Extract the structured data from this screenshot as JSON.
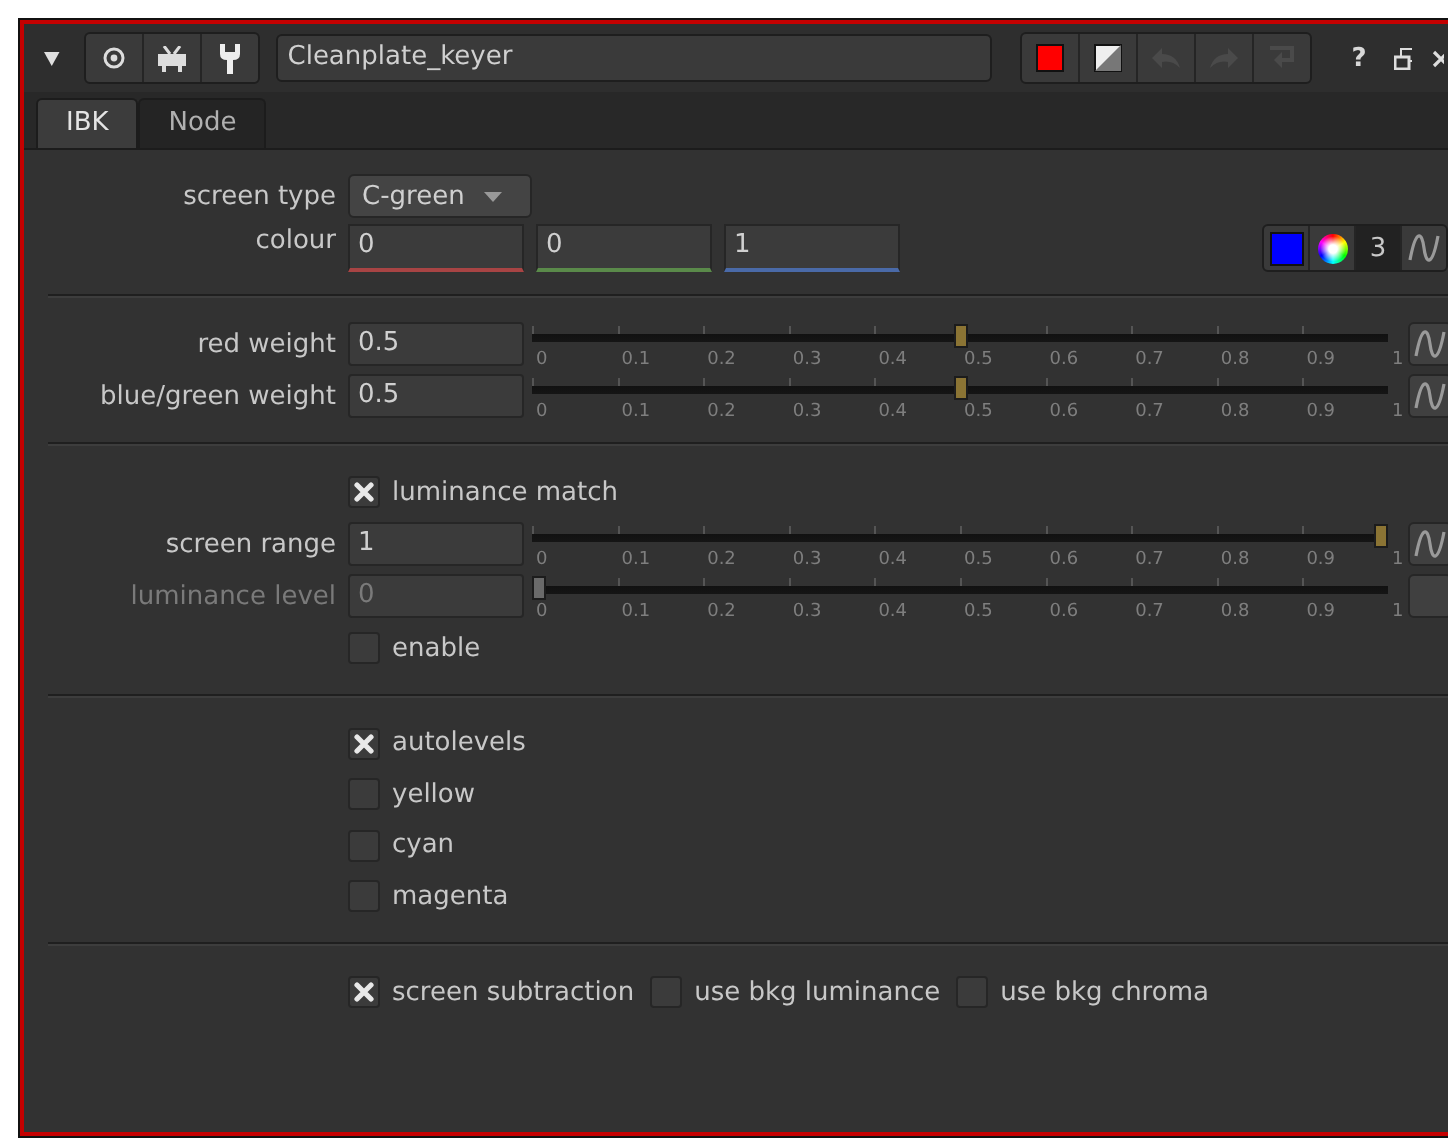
{
  "header": {
    "name": "Cleanplate_keyer",
    "help": "?"
  },
  "tabs": [
    {
      "label": "IBK",
      "selected": true
    },
    {
      "label": "Node",
      "selected": false
    }
  ],
  "screen_type": {
    "label": "screen type",
    "value": "C-green"
  },
  "colour": {
    "label": "colour",
    "values": [
      "0",
      "0",
      "1"
    ],
    "color": "#0000ff",
    "channels": "3"
  },
  "weights": [
    {
      "label": "red weight",
      "value": "0.5",
      "level": 0.5,
      "disabled": false,
      "ticks": [
        "0",
        "0.1",
        "0.2",
        "0.3",
        "0.4",
        "0.5",
        "0.6",
        "0.7",
        "0.8",
        "0.9",
        "1"
      ]
    },
    {
      "label": "blue/green weight",
      "value": "0.5",
      "level": 0.5,
      "disabled": false,
      "ticks": [
        "0",
        "0.1",
        "0.2",
        "0.3",
        "0.4",
        "0.5",
        "0.6",
        "0.7",
        "0.8",
        "0.9",
        "1"
      ]
    }
  ],
  "luminance_match": {
    "label": "luminance match",
    "checked": true
  },
  "ranges": [
    {
      "label": "screen range",
      "value": "1",
      "level": 1,
      "disabled": false,
      "ticks": [
        "0",
        "0.1",
        "0.2",
        "0.3",
        "0.4",
        "0.5",
        "0.6",
        "0.7",
        "0.8",
        "0.9",
        "1"
      ]
    },
    {
      "label": "luminance level",
      "value": "0",
      "level": 0,
      "disabled": true,
      "ticks": [
        "0",
        "0.1",
        "0.2",
        "0.3",
        "0.4",
        "0.5",
        "0.6",
        "0.7",
        "0.8",
        "0.9",
        "1"
      ]
    }
  ],
  "enable": {
    "label": "enable",
    "checked": false
  },
  "level_options": [
    {
      "label": "autolevels",
      "checked": true
    },
    {
      "label": "yellow",
      "checked": false
    },
    {
      "label": "cyan",
      "checked": false
    },
    {
      "label": "magenta",
      "checked": false
    }
  ],
  "subtraction_options": [
    {
      "label": "screen subtraction",
      "checked": true
    },
    {
      "label": "use bkg luminance",
      "checked": false
    },
    {
      "label": "use bkg chroma",
      "checked": false
    }
  ]
}
